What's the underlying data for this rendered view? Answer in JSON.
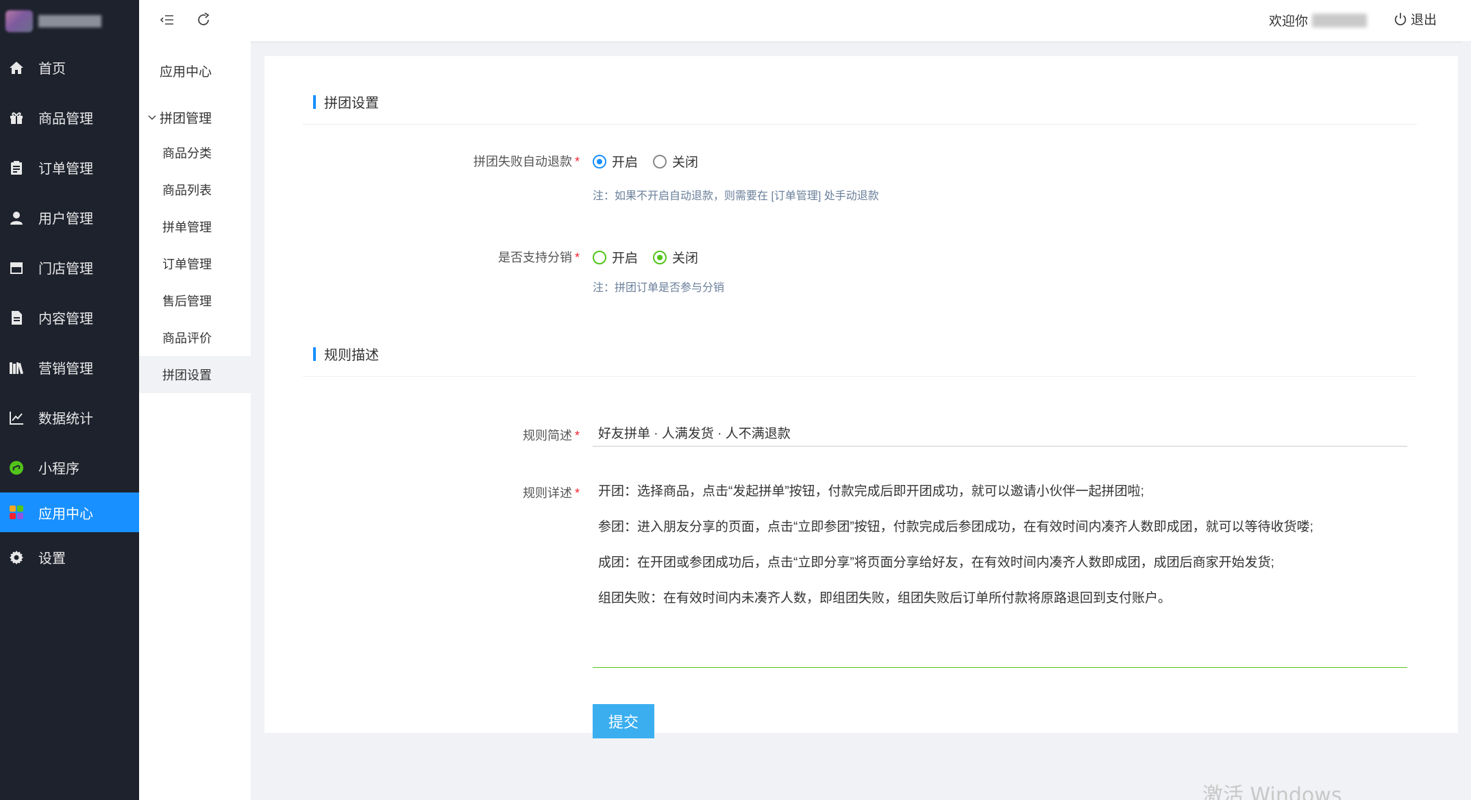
{
  "sidebar": {
    "items": [
      {
        "label": "首页",
        "icon": "home-icon"
      },
      {
        "label": "商品管理",
        "icon": "gift-icon"
      },
      {
        "label": "订单管理",
        "icon": "clipboard-icon"
      },
      {
        "label": "用户管理",
        "icon": "user-icon"
      },
      {
        "label": "门店管理",
        "icon": "store-icon"
      },
      {
        "label": "内容管理",
        "icon": "document-icon"
      },
      {
        "label": "营销管理",
        "icon": "books-icon"
      },
      {
        "label": "数据统计",
        "icon": "line-chart-icon"
      },
      {
        "label": "小程序",
        "icon": "mini-program-icon"
      },
      {
        "label": "应用中心",
        "icon": "apps-icon"
      },
      {
        "label": "设置",
        "icon": "gear-icon"
      }
    ],
    "active_index": 9
  },
  "header": {
    "welcome": "欢迎你",
    "logout": "退出"
  },
  "subnav": {
    "title": "应用中心",
    "group": "拼团管理",
    "items": [
      "商品分类",
      "商品列表",
      "拼单管理",
      "订单管理",
      "售后管理",
      "商品评价",
      "拼团设置"
    ],
    "active_index": 6
  },
  "form": {
    "section1": "拼团设置",
    "refund_label": "拼团失败自动退款",
    "refund_options": [
      "开启",
      "关闭"
    ],
    "refund_selected": "开启",
    "refund_note": "注：如果不开启自动退款，则需要在 [订单管理] 处手动退款",
    "distribution_label": "是否支持分销",
    "distribution_options": [
      "开启",
      "关闭"
    ],
    "distribution_selected": "关闭",
    "distribution_note": "注：拼团订单是否参与分销",
    "section2": "规则描述",
    "summary_label": "规则简述",
    "summary_value": "好友拼单 · 人满发货 · 人不满退款",
    "detail_label": "规则详述",
    "detail_lines": [
      "开团：选择商品，点击“发起拼单”按钮，付款完成后即开团成功，就可以邀请小伙伴一起拼团啦;",
      "参团：进入朋友分享的页面，点击“立即参团”按钮，付款完成后参团成功，在有效时间内凑齐人数即成团，就可以等待收货喽;",
      "成团：在开团或参团成功后，点击“立即分享”将页面分享给好友，在有效时间内凑齐人数即成团，成团后商家开始发货;",
      "组团失败：在有效时间内未凑齐人数，即组团失败，组团失败后订单所付款将原路退回到支付账户。"
    ],
    "submit": "提交"
  },
  "watermark": "激活 Windows",
  "colors": {
    "sidebar_bg": "#1e222d",
    "accent": "#1890ff",
    "submit_bg": "#3baef0",
    "green": "#52c41a"
  }
}
